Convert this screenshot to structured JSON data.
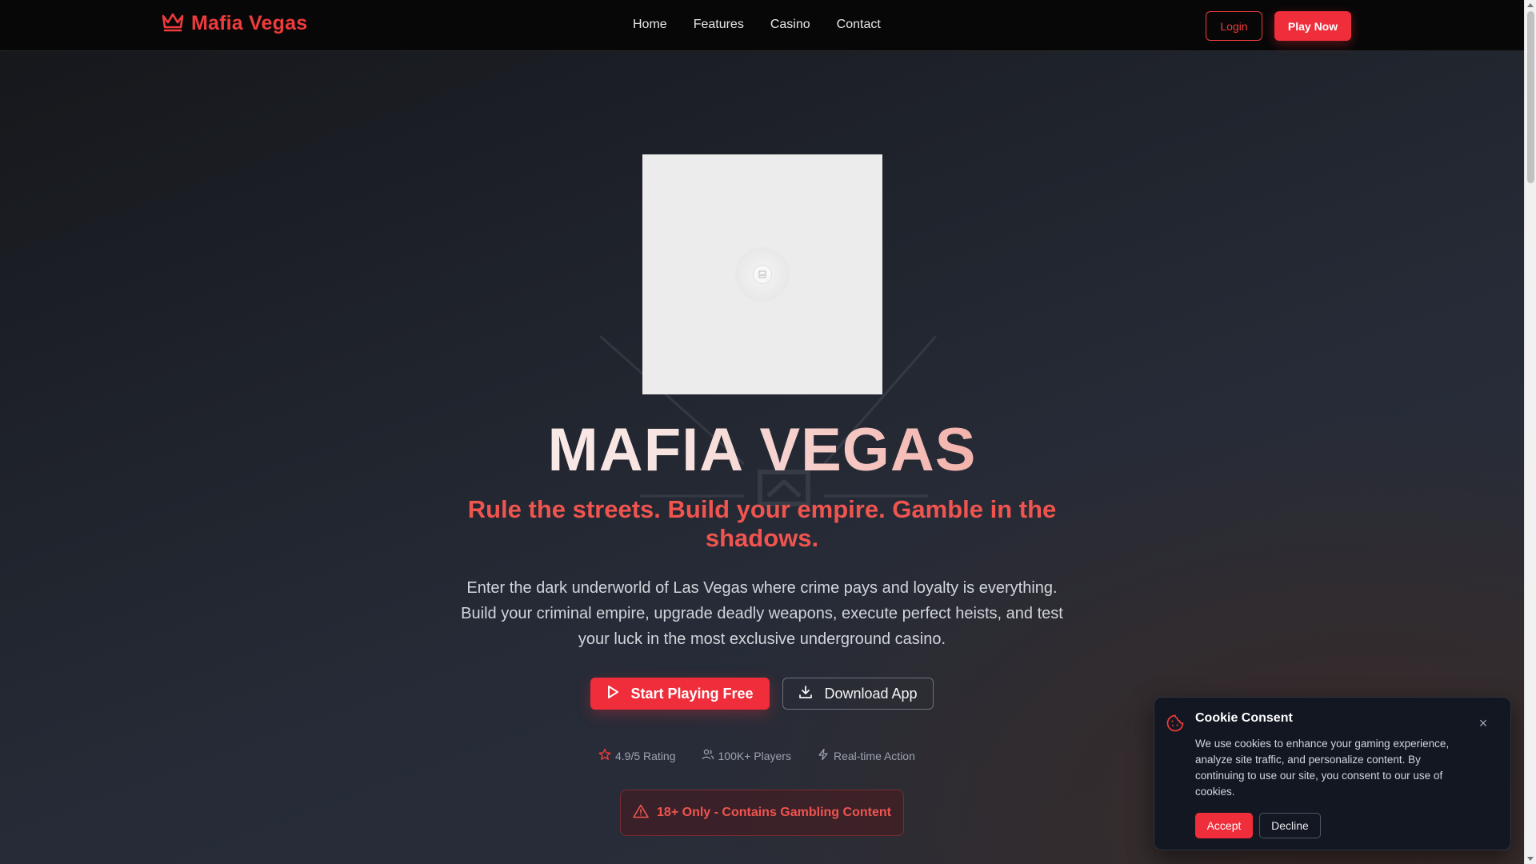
{
  "nav": {
    "brand": "Mafia Vegas",
    "links": [
      "Home",
      "Features",
      "Casino",
      "Contact"
    ],
    "login_label": "Login",
    "play_label": "Play Now"
  },
  "hero": {
    "title": "MAFIA VEGAS",
    "tagline": "Rule the streets. Build your empire. Gamble in the shadows.",
    "intro": "Enter the dark underworld of Las Vegas where crime pays and loyalty is everything. Build your criminal empire, upgrade deadly weapons, execute perfect heists, and test your luck in the most exclusive underground casino.",
    "start_label": "Start Playing Free",
    "download_label": "Download App",
    "stats": [
      {
        "icon": "star-icon",
        "label": "4.9/5 Rating"
      },
      {
        "icon": "users-icon",
        "label": "100K+ Players"
      },
      {
        "icon": "lightning-icon",
        "label": "Real-time Action"
      }
    ],
    "warning": "18+ Only - Contains Gambling Content"
  },
  "cookie": {
    "title": "Cookie Consent",
    "text": "We use cookies to enhance your gaming experience, analyze site traffic, and personalize content. By continuing to use our site, you consent to our use of cookies.",
    "accept_label": "Accept",
    "decline_label": "Decline"
  },
  "colors": {
    "accent": "#ef2d3b",
    "brand_red": "#ef3b3b",
    "nav_bg": "#070707",
    "cookie_bg": "#131722"
  }
}
